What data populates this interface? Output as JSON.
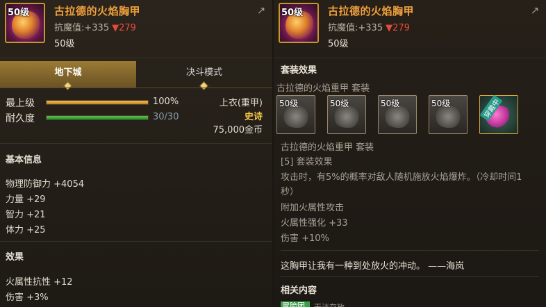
{
  "left": {
    "header": {
      "level_badge": "50级",
      "item_name": "古拉德的火焰胸甲",
      "resist_label": "抗魔值:+335",
      "resist_delta": "▼279",
      "level_text": "50级"
    },
    "tabs": [
      {
        "label": "地下城",
        "active": true
      },
      {
        "label": "决斗模式",
        "active": false
      }
    ],
    "stats": {
      "grade_label": "最上级",
      "grade_value": "100%",
      "grade_fill": 1.0,
      "durability_label": "耐久度",
      "durability_value": "30/30",
      "durability_fill": 1.0,
      "slot_type": "上衣(重甲)",
      "rarity": "史诗",
      "price": "75,000金币"
    },
    "basic_info": {
      "title": "基本信息",
      "lines": [
        "物理防御力 +4054",
        "力量 +29",
        "智力 +21",
        "体力 +25"
      ]
    },
    "effects": {
      "title": "效果",
      "lines": [
        "火属性抗性 +12",
        "伤害 +3%"
      ]
    }
  },
  "right": {
    "header": {
      "level_badge": "50级",
      "item_name": "古拉德的火焰胸甲",
      "resist_label": "抗魔值:+335",
      "resist_delta": "▼279",
      "level_text": "50级"
    },
    "set_title": "套装效果",
    "set_name": "古拉德的火焰重甲  套装",
    "set_slots": [
      {
        "badge": "50级",
        "equipped": false
      },
      {
        "badge": "50级",
        "equipped": false
      },
      {
        "badge": "50级",
        "equipped": false
      },
      {
        "badge": "50级",
        "equipped": false
      },
      {
        "badge": "",
        "equipped": true,
        "tag": "穿戴中"
      }
    ],
    "set_detail": {
      "name": "古拉德的火焰重甲  套装",
      "bonus_label": "[5] 套装效果",
      "desc_1": "攻击时，有5%的概率对敌人随机施放火焰爆炸。（冷却时间1",
      "desc_2": "秒）",
      "extra_1": "附加火属性攻击",
      "extra_2": "火属性强化 +33",
      "extra_3": "伤害 +10%"
    },
    "quote": "这胸甲让我有一种到处放火的冲动。 ——海岚",
    "related_title": "相关内容",
    "related_tag": "冒险团金库",
    "related_text": "无法存放"
  },
  "colors": {
    "item_name": "#f0a03c",
    "delta": "#e84a3a",
    "rarity": "#f2c84a",
    "grade_bar": "#e0a030",
    "durability_bar": "#3aa43a"
  },
  "icons": [
    "share-icon"
  ]
}
